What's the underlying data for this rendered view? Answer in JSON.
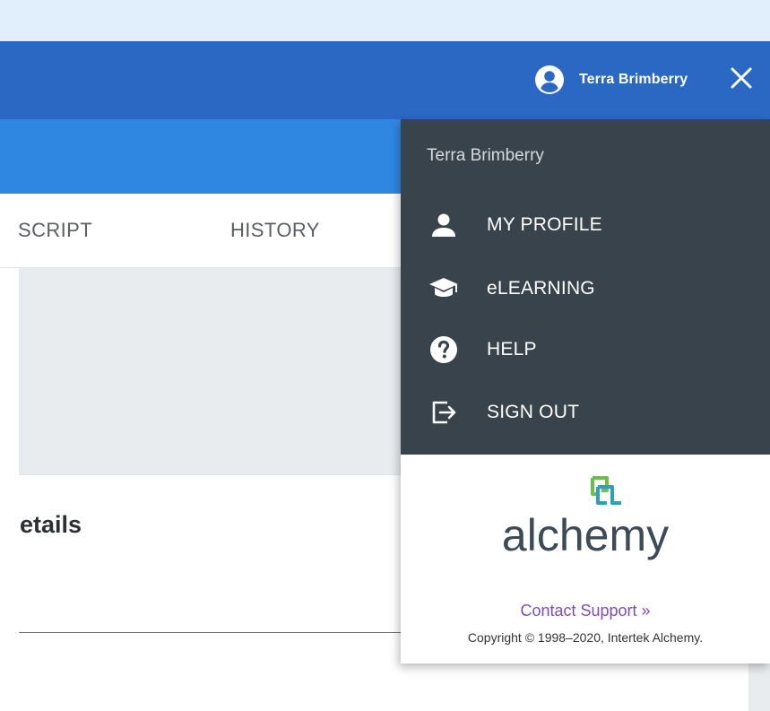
{
  "header": {
    "user_name": "Terra Brimberry",
    "avatar_icon": "account-circle-icon",
    "close_icon": "close-icon"
  },
  "tabs": [
    {
      "label": "SCRIPT"
    },
    {
      "label": "HISTORY"
    }
  ],
  "main": {
    "section_heading": "etails"
  },
  "user_menu": {
    "user_name": "Terra Brimberry",
    "items": [
      {
        "label": "MY PROFILE",
        "icon": "person-icon"
      },
      {
        "label": "eLEARNING",
        "icon": "graduation-cap-icon"
      },
      {
        "label": "HELP",
        "icon": "question-circle-icon"
      },
      {
        "label": "SIGN OUT",
        "icon": "sign-out-icon"
      }
    ],
    "logo_text": "alchemy",
    "contact_link": "Contact Support »",
    "copyright": "Copyright © 1998–2020, Intertek Alchemy."
  },
  "colors": {
    "top_strip": "#e1eefb",
    "app_bar": "#2b68c4",
    "sub_bar": "#3087e2",
    "menu_dark": "#39434b",
    "link": "#7e4db3",
    "logo_green": "#6cbf4a",
    "logo_teal": "#2aa3b8",
    "logo_text": "#3d4a57"
  }
}
